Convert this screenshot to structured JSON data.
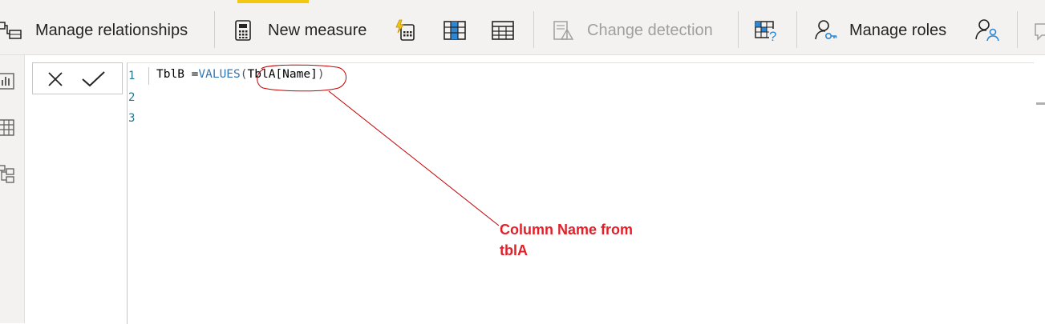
{
  "ribbon": {
    "manage_relationships": "Manage relationships",
    "new_measure": "New measure",
    "change_detection": "Change detection",
    "manage_roles": "Manage roles"
  },
  "editor": {
    "line_numbers": [
      "1",
      "2",
      "3"
    ],
    "code": {
      "table_name": "TblB",
      "assign": " =",
      "function": "VALUES",
      "open_paren": "(",
      "argument": "TblA[Name]",
      "close_paren": ")"
    }
  },
  "annotation": {
    "line1": "Column Name from",
    "line2": "tblA",
    "color": "#e3202a"
  },
  "colors": {
    "accent": "#f2c811",
    "function_blue": "#3176b4",
    "line_number": "#237893"
  }
}
